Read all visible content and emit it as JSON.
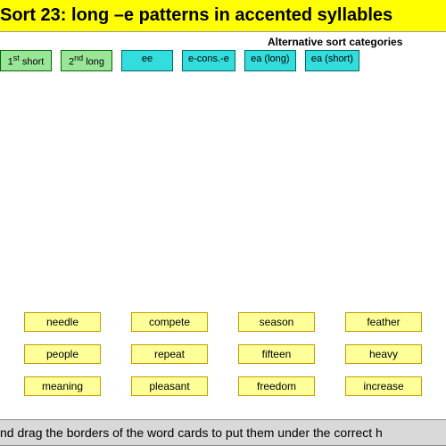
{
  "title": " Sort 23: long –e patterns in accented syllables",
  "alt_label": "Alternative sort categories",
  "categories": {
    "primary": [
      {
        "label_html": "1<sup>st</sup> short"
      },
      {
        "label_html": "2<sup>nd</sup> long"
      }
    ],
    "alternative": [
      {
        "label": "ee"
      },
      {
        "label": "e-cons.-e"
      },
      {
        "label": "ea (long)"
      },
      {
        "label": "ea (short)"
      }
    ]
  },
  "words": {
    "row1": [
      "needle",
      "compete",
      "season",
      "feather"
    ],
    "row2": [
      "people",
      "repeat",
      "fifteen",
      "heavy"
    ],
    "row3": [
      "meaning",
      "pleasant",
      "freedom",
      "increase"
    ]
  },
  "instructions": "nd drag the borders of the word cards to put them under the correct h"
}
